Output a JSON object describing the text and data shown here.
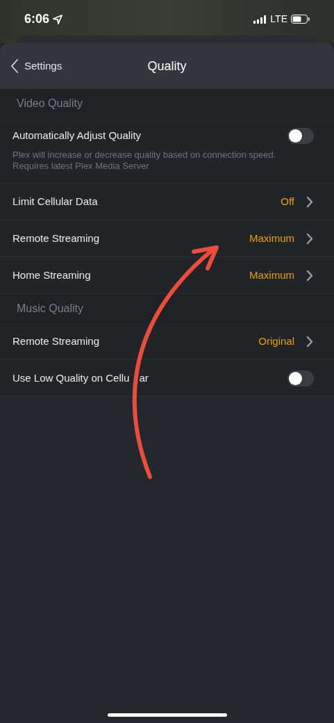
{
  "status_bar": {
    "time": "6:06",
    "network": "LTE"
  },
  "nav": {
    "back": "Settings",
    "title": "Quality"
  },
  "sections": [
    {
      "title": "Video Quality",
      "rows": [
        {
          "kind": "toggle",
          "label": "Automatically Adjust Quality",
          "on": false,
          "description": "Plex will increase or decrease quality based on connection speed. Requires latest Plex Media Server"
        },
        {
          "kind": "link",
          "label": "Limit Cellular Data",
          "value": "Off"
        },
        {
          "kind": "link",
          "label": "Remote Streaming",
          "value": "Maximum"
        },
        {
          "kind": "link",
          "label": "Home Streaming",
          "value": "Maximum"
        }
      ]
    },
    {
      "title": "Music Quality",
      "rows": [
        {
          "kind": "link",
          "label": "Remote Streaming",
          "value": "Original"
        },
        {
          "kind": "toggle",
          "label": "Use Low Quality on Cellu",
          "label_after_arrow": "ar",
          "on": false
        }
      ]
    }
  ]
}
